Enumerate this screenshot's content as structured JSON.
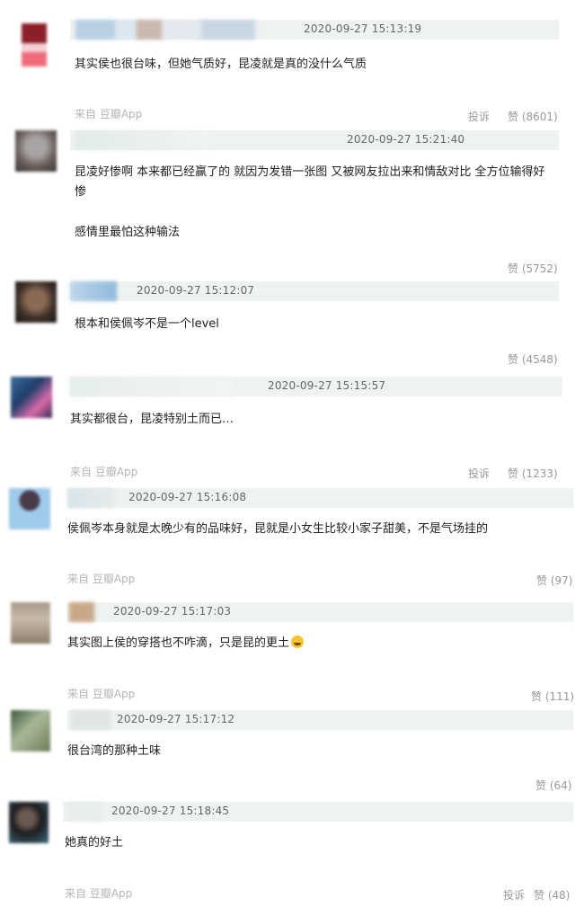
{
  "comments": [
    {
      "time": "2020-09-27 15:13:19",
      "text": "其实侯也很台味，但她气质好，昆凌就是真的没什么气质",
      "source": "来自 豆瓣App",
      "report": "投诉",
      "like": "赞 (8601)"
    },
    {
      "time": "2020-09-27 15:21:40",
      "text_lines": [
        "昆凌好惨啊 本来都已经赢了的 就因为发错一张图 又被网友拉出来和情敌对比 全方位输得好",
        "惨"
      ],
      "text2": "感情里最怕这种输法",
      "like": "赞 (5752)"
    },
    {
      "time": "2020-09-27 15:12:07",
      "text": "根本和侯佩岑不是一个level",
      "like": "赞 (4548)"
    },
    {
      "time": "2020-09-27 15:15:57",
      "text": "其实都很台，昆凌特别土而已…",
      "source": "来自 豆瓣App",
      "report": "投诉",
      "like": "赞 (1233)"
    },
    {
      "time": "2020-09-27 15:16:08",
      "text": "侯佩岑本身就是太晚少有的品味好，昆就是小女生比较小家子甜美，不是气场挂的",
      "source": "来自 豆瓣App",
      "like": "赞 (97)"
    },
    {
      "time": "2020-09-27 15:17:03",
      "text": "其实图上侯的穿搭也不咋滴，只是昆的更土",
      "emoji": "laughing-emoji",
      "source": "来自 豆瓣App",
      "like": "赞 (111)"
    },
    {
      "time": "2020-09-27 15:17:12",
      "text": "很台湾的那种土味",
      "like": "赞 (64)"
    },
    {
      "time": "2020-09-27 15:18:45",
      "text": "她真的好土",
      "source": "来自 豆瓣App",
      "report": "投诉",
      "like": "赞 (48)"
    }
  ]
}
